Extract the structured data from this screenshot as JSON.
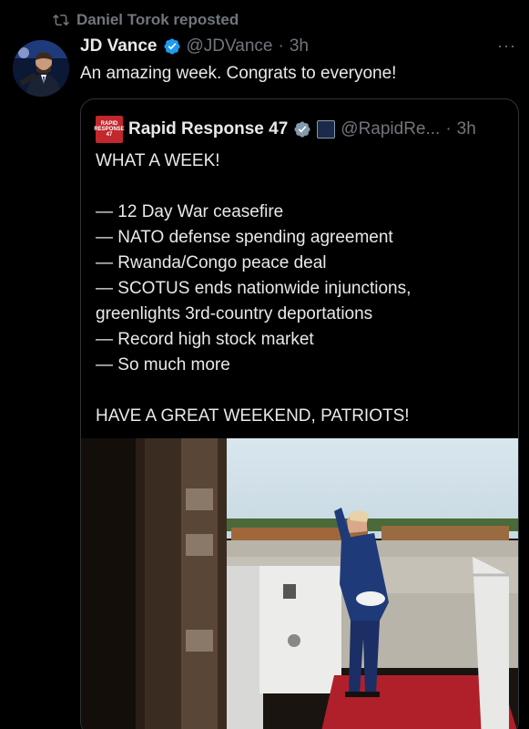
{
  "repost": {
    "text": "Daniel Torok reposted"
  },
  "tweet": {
    "name": "JD Vance",
    "handle": "@JDVance",
    "separator": "·",
    "time": "3h",
    "more": "···",
    "text": "An amazing week. Congrats to everyone!"
  },
  "quote": {
    "name": "Rapid Response 47",
    "handle": "@RapidRe...",
    "separator": "·",
    "time": "3h",
    "logo_text": [
      "RAPID",
      "RESPONSE",
      "47"
    ],
    "lines": [
      "WHAT A WEEK!",
      "",
      "— 12 Day War ceasefire",
      "— NATO defense spending agreement",
      "— Rwanda/Congo peace deal",
      "— SCOTUS ends nationwide injunctions,",
      "greenlights 3rd-country deportations",
      "— Record high stock market",
      "— So much more",
      "",
      "HAVE A GREAT WEEKEND, PATRIOTS!"
    ]
  },
  "colors": {
    "background": "#000000",
    "text": "#e7e9ea",
    "muted": "#71767b",
    "verified": "#1d9bf0",
    "border": "#2f3336",
    "logo": "#c1272d"
  }
}
